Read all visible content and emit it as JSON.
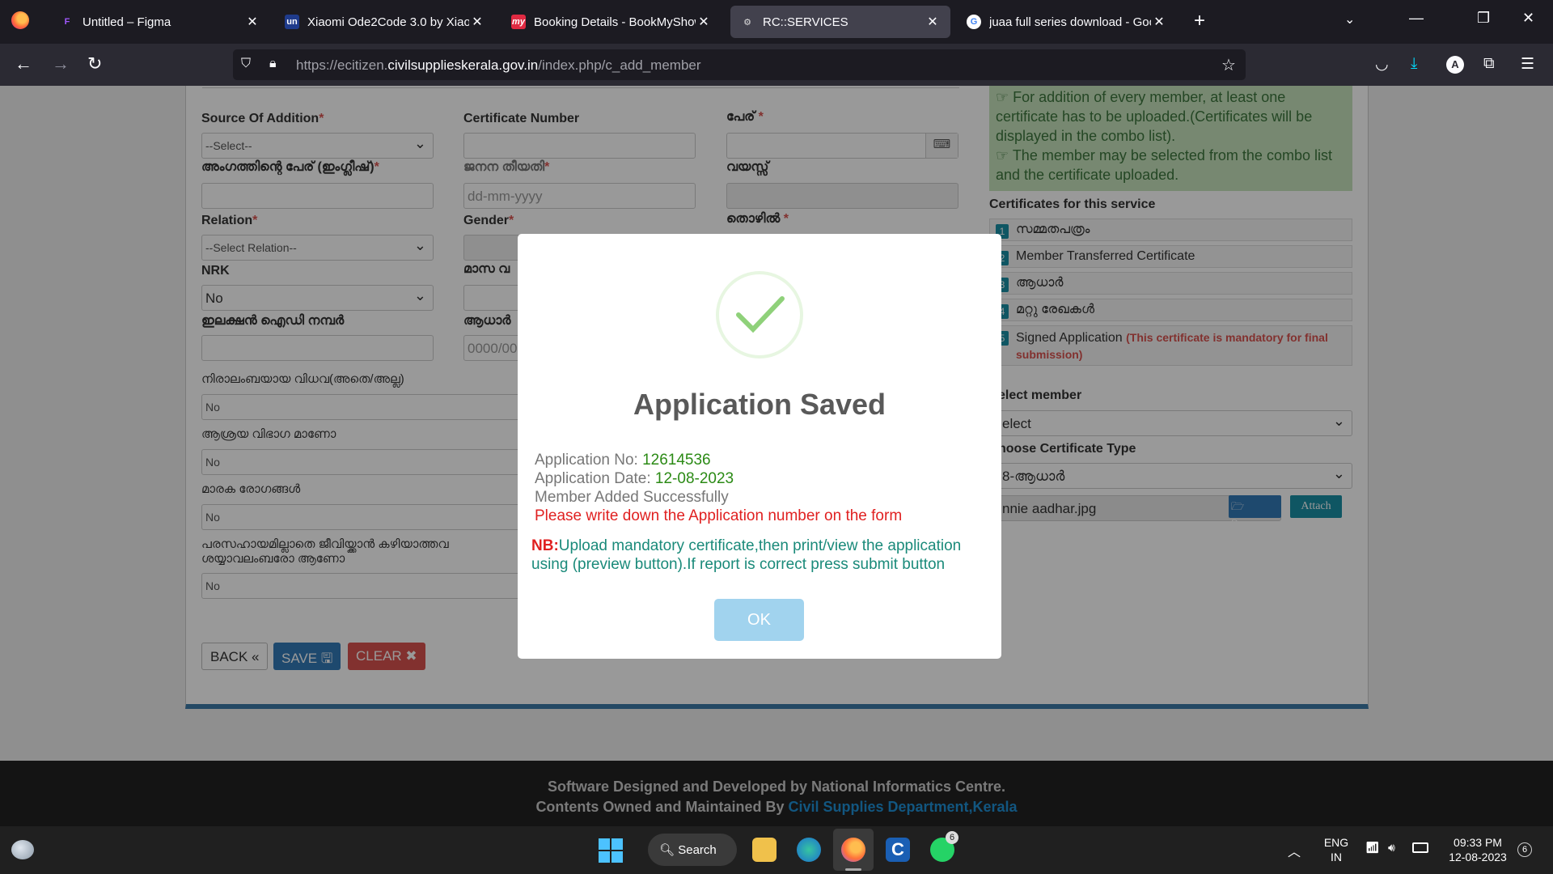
{
  "browser": {
    "tabs": [
      {
        "title": "Untitled – Figma",
        "favicon": "F",
        "favicon_color": "#a259ff"
      },
      {
        "title": "Xiaomi Ode2Code 3.0 by Xiaomi",
        "favicon": "un",
        "favicon_color": "#1f3b8c"
      },
      {
        "title": "Booking Details - BookMyShow",
        "favicon": "my",
        "favicon_color": "#e02a42"
      },
      {
        "title": "RC::SERVICES",
        "favicon": "⚙",
        "favicon_color": "#c0c0c0"
      },
      {
        "title": "juaa full series download - Goo",
        "favicon": "G",
        "favicon_color": "#ffffff"
      }
    ],
    "url_prefix": "https://ecitizen.",
    "url_domain": "civilsupplieskerala.gov.in",
    "url_suffix": "/index.php/c_add_member"
  },
  "form": {
    "source_label": "Source Of Addition",
    "source_value": "--Select--",
    "certificate_number_label": "Certificate Number",
    "name_label": "പേര്",
    "member_name_en_label": "അംഗത്തിന്റെ പേര് (ഇംഗ്ലീഷ്)",
    "dob_label": "ജനന തീയതി",
    "dob_placeholder": "dd-mm-yyyy",
    "age_label": "വയസ്സ്",
    "relation_label": "Relation",
    "relation_value": "--Select Relation--",
    "gender_label": "Gender",
    "occupation_label": "തൊഴിൽ",
    "nrk_label": "NRK",
    "nrk_value": "No",
    "monthly_label": "മാസ വ",
    "election_id_label": "ഇലക്ഷൻ ഐഡി നമ്പർ",
    "aadhaar_label": "ആധാർ",
    "aadhaar_placeholder": "0000/00",
    "q1_label": "നിരാലംബയായ വിധവ(അതെ/അല്ല)",
    "q1_value": "No",
    "q2_label": "ആശ്രയ വിഭാഗ മാണോ",
    "q2_value": "No",
    "q3_label": "മാരക രോഗങ്ങൾ",
    "q3_value": "No",
    "q4_label_line1": "പരസഹായമില്ലാതെ ജീവിയ്ക്കാൻ കഴിയാത്തവ",
    "q4_label_line2": "ശയ്യാവലംബരോ ആണോ",
    "q4_value": "No",
    "back_label": "BACK «",
    "save_label": "SAVE 🖫",
    "clear_label": "CLEAR ✖"
  },
  "sidebar": {
    "note_line1": "☞ For addition of every member, at least one certificate has to be uploaded.(Certificates will be displayed in the combo list).",
    "note_line2": "☞ The member may be selected from the combo list and the certificate uploaded.",
    "certs_heading": "Certificates for this service",
    "certs": [
      {
        "num": "1",
        "label": "സമ്മതപത്രം"
      },
      {
        "num": "2",
        "label": "Member Transferred Certificate"
      },
      {
        "num": "3",
        "label": "ആധാർ"
      },
      {
        "num": "4",
        "label": "മറ്റു രേഖകൾ"
      },
      {
        "num": "5",
        "label": "Signed Application",
        "mandatory": "(This certificate is mandatory for final submission)"
      }
    ],
    "select_member_label": "elect member",
    "select_member_value": "elect",
    "cert_type_label": "hoose Certificate Type",
    "cert_type_value": "8-ആധാർ",
    "file_name": "nnie aadhar.jpg",
    "browse_label": "Browse",
    "attach_label": "Attach"
  },
  "modal": {
    "title": "Application Saved",
    "app_no_label": "Application No: ",
    "app_no": "12614536",
    "app_date_label": "Application Date: ",
    "app_date": "12-08-2023",
    "member_added": "Member Added Successfully",
    "warning": "Please write down the Application number on the form",
    "nb_label": "NB:",
    "nb_text": "Upload mandatory certificate,then print/view the application using (preview button).If report is correct press submit button",
    "ok_label": "OK"
  },
  "footer": {
    "line1": "Software Designed and Developed by National Informatics Centre.",
    "line2_prefix": "Contents Owned and Maintained By ",
    "line2_link": "Civil Supplies Department,Kerala"
  },
  "taskbar": {
    "search_label": "Search",
    "lang_line1": "ENG",
    "lang_line2": "IN",
    "time": "09:33 PM",
    "date": "12-08-2023",
    "notif_count": "6",
    "whatsapp_badge": "6"
  }
}
